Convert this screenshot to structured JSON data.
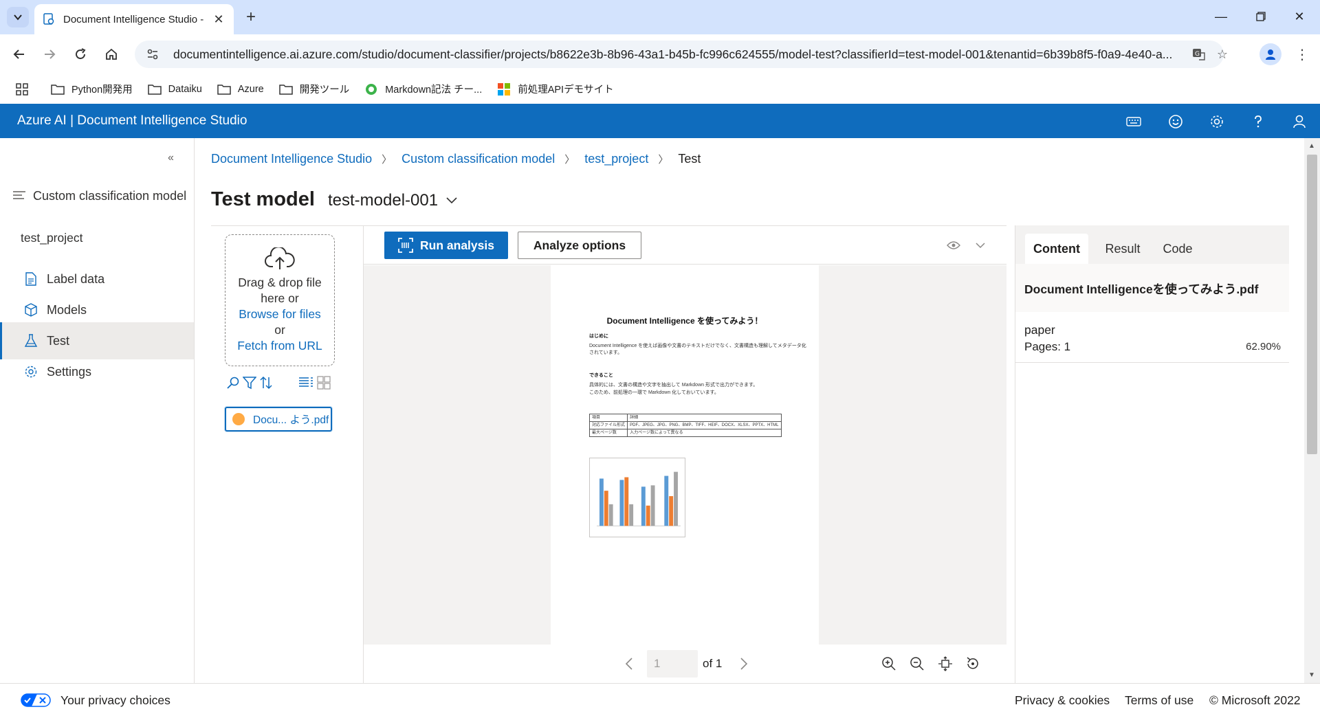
{
  "browser": {
    "tab_title": "Document Intelligence Studio -",
    "url": "documentintelligence.ai.azure.com/studio/document-classifier/projects/b8622e3b-8b96-43a1-b45b-fc996c624555/model-test?classifierId=test-model-001&tenantid=6b39b8f5-f0a9-4e40-a...",
    "bookmarks": [
      "Python開発用",
      "Dataiku",
      "Azure",
      "開発ツール",
      "Markdown記法 チー...",
      "前処理APIデモサイト"
    ]
  },
  "app": {
    "title": "Azure AI | Document Intelligence Studio"
  },
  "leftnav": {
    "context": "Custom classification model",
    "project": "test_project",
    "items": [
      {
        "label": "Label data",
        "icon": "document-icon"
      },
      {
        "label": "Models",
        "icon": "cube-icon"
      },
      {
        "label": "Test",
        "icon": "flask-icon"
      },
      {
        "label": "Settings",
        "icon": "gear-icon"
      }
    ]
  },
  "breadcrumb": [
    "Document Intelligence Studio",
    "Custom classification model",
    "test_project",
    "Test"
  ],
  "page": {
    "title": "Test model",
    "model": "test-model-001"
  },
  "upload": {
    "drag_text_1": "Drag & drop file",
    "drag_text_2": "here or",
    "browse": "Browse for files",
    "or": "or",
    "fetch": "Fetch from URL",
    "file_name": "Docu... よう.pdf"
  },
  "viewer": {
    "run_label": "Run analysis",
    "options_label": "Analyze options",
    "page_value": "1",
    "page_of": "of 1",
    "doc": {
      "title": "Document Intelligence を使ってみよう！",
      "h1": "はじめに",
      "p1a": "Document Intelligence を使えば画像や文書のテキストだけでなく、文書構造も理解してメタデータ化",
      "p1b": "されています。",
      "h2": "できること",
      "p2a": "具体的には、文書の構造や文字を抽出して Markdown 形式で出力ができます。",
      "p2b": "このため、前処理の一環で Markdown 化しておいています。",
      "table": [
        [
          "項目",
          "詳細"
        ],
        [
          "対応ファイル形式",
          "PDF、JPEG、JPG、PNG、BMP、TIFF、HEIF、DOCX、XLSX、PPTX、HTML"
        ],
        [
          "最大ページ数",
          "入力ページ数によって異なる"
        ]
      ]
    }
  },
  "results": {
    "tabs": [
      "Content",
      "Result",
      "Code"
    ],
    "file": "Document Intelligenceを使ってみよう.pdf",
    "doc_type": "paper",
    "pages": "Pages: 1",
    "confidence": "62.90%"
  },
  "footer": {
    "privacy": "Your privacy choices",
    "privacy_cookies": "Privacy & cookies",
    "terms": "Terms of use",
    "copyright": "© Microsoft 2022"
  },
  "colors": {
    "accent": "#0f6cbd",
    "file_dot": "#ffaa44"
  }
}
